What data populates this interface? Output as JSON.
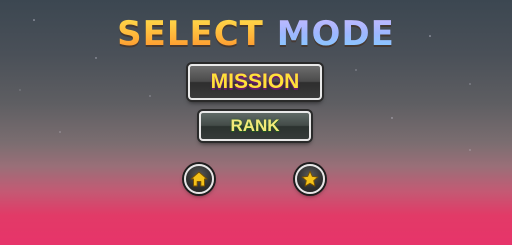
{
  "title": {
    "word1": "SELECT",
    "word2": "MODE"
  },
  "buttons": {
    "mission_label": "MISSION",
    "rank_label": "RANK"
  },
  "icons": {
    "home": "home-icon",
    "star": "star-icon"
  },
  "colors": {
    "title_gold": "#ffb53a",
    "title_blue": "#9db7ff",
    "icon_gold": "#f4c21a",
    "background_bottom": "#e7346a",
    "background_top": "#3c4751"
  }
}
